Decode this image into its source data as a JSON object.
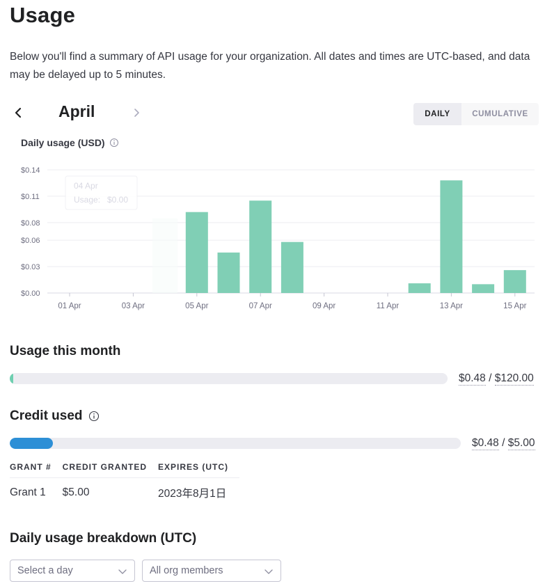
{
  "page": {
    "title": "Usage",
    "intro": "Below you'll find a summary of API usage for your organization. All dates and times are UTC-based, and data may be delayed up to 5 minutes."
  },
  "month_nav": {
    "month": "April",
    "prev_icon": "chevron-left-icon",
    "next_icon": "chevron-right-icon"
  },
  "view_toggle": {
    "daily_label": "DAILY",
    "cumulative_label": "CUMULATIVE",
    "selected": "DAILY"
  },
  "chart_data": {
    "type": "bar",
    "title": "Daily usage (USD)",
    "y_tick_labels": [
      "$0.14",
      "$0.11",
      "$0.08",
      "$0.06",
      "$0.03",
      "$0.00"
    ],
    "y_ticks": [
      0.14,
      0.11,
      0.08,
      0.06,
      0.03,
      0.0
    ],
    "ylim": [
      0,
      0.14
    ],
    "x_tick_labels": [
      "01 Apr",
      "03 Apr",
      "05 Apr",
      "07 Apr",
      "09 Apr",
      "11 Apr",
      "13 Apr",
      "15 Apr"
    ],
    "categories": [
      "01 Apr",
      "02 Apr",
      "03 Apr",
      "04 Apr",
      "05 Apr",
      "06 Apr",
      "07 Apr",
      "08 Apr",
      "09 Apr",
      "10 Apr",
      "11 Apr",
      "12 Apr",
      "13 Apr",
      "14 Apr",
      "15 Apr"
    ],
    "values": [
      0,
      0,
      0,
      0,
      0.092,
      0.046,
      0.105,
      0.058,
      0,
      0,
      0,
      0.011,
      0.128,
      0.01,
      0.026
    ],
    "grid": true,
    "bar_color": "#80cfb5",
    "tooltip": {
      "date": "04 Apr",
      "label": "Usage:",
      "value": "$0.00"
    }
  },
  "usage_this_month": {
    "title": "Usage this month",
    "used": "$0.48",
    "separator": "/",
    "limit": "$120.00",
    "fraction": 0.004,
    "fill_color": "#6fcfb0"
  },
  "credit_used": {
    "title": "Credit used",
    "info_icon": "info-icon",
    "used": "$0.48",
    "separator": "/",
    "total": "$5.00",
    "fraction": 0.096,
    "fill_color": "#2d8fd6"
  },
  "grants": {
    "headers": [
      "GRANT #",
      "CREDIT GRANTED",
      "EXPIRES (UTC)"
    ],
    "rows": [
      [
        "Grant 1",
        "$5.00",
        "2023年8月1日"
      ]
    ]
  },
  "breakdown": {
    "title": "Daily usage breakdown (UTC)",
    "day_select_placeholder": "Select a day",
    "members_select_value": "All org members"
  }
}
